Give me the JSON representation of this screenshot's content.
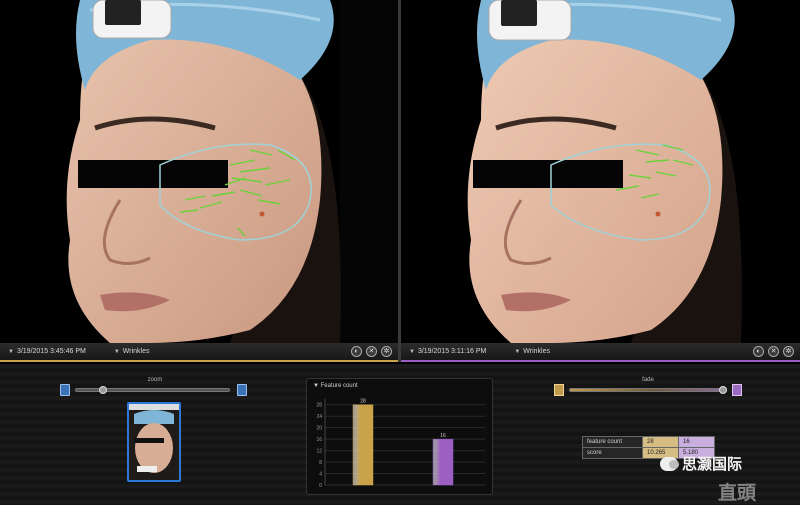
{
  "left_pane": {
    "timestamp": "3/19/2015 3:45:46 PM",
    "mode": "Wrinkles",
    "accent": "#c9a24a"
  },
  "right_pane": {
    "timestamp": "3/19/2015 3:11:16 PM",
    "mode": "Wrinkles",
    "accent": "#9a5fc0"
  },
  "toolbar_icons": [
    "contrast-icon",
    "close-icon",
    "settings-icon"
  ],
  "zoom": {
    "label": "zoom",
    "level": 0.18
  },
  "fade": {
    "label": "fade",
    "level": 0.98
  },
  "feature_count_chart": {
    "title": "Feature count"
  },
  "chart_data": {
    "type": "bar",
    "categories": [
      "3/19/2015 3:45:46 PM",
      "3/19/2015 3:11:16 PM"
    ],
    "values": [
      28,
      16
    ],
    "ylim": [
      0,
      30
    ],
    "yticks": [
      "28",
      "24",
      "20",
      "16",
      "12",
      "8",
      "4",
      "0"
    ],
    "data_labels": [
      "28",
      "16"
    ],
    "colors": [
      "#c9a24a",
      "#9a5fc0"
    ],
    "grid": true
  },
  "stats_table": {
    "rows": [
      {
        "label": "feature count",
        "left": "28",
        "right": "16"
      },
      {
        "label": "score",
        "left": "10.265",
        "right": "5.180"
      }
    ]
  },
  "watermark": {
    "brand": "思灏国际",
    "sub": "直頭"
  }
}
